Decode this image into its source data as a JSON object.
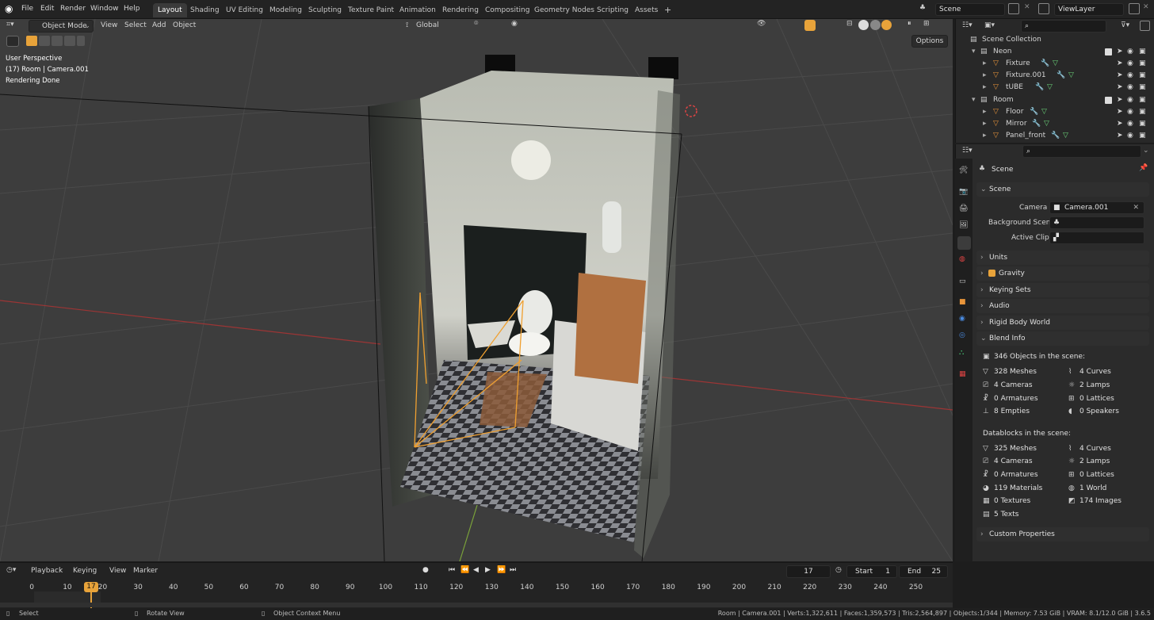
{
  "topbar": {
    "menus": [
      "File",
      "Edit",
      "Render",
      "Window",
      "Help"
    ],
    "workspaces": [
      "Layout",
      "Shading",
      "UV Editing",
      "Modeling",
      "Sculpting",
      "Texture Paint",
      "Animation",
      "Rendering",
      "Compositing",
      "Geometry Nodes",
      "Scripting",
      "Assets"
    ],
    "active_workspace": "Layout",
    "add_workspace": "+",
    "scene_label": "Scene",
    "viewlayer_label": "ViewLayer"
  },
  "viewport_header": {
    "mode": "Object Mode",
    "menus": [
      "View",
      "Select",
      "Add",
      "Object"
    ],
    "orientation": "Global",
    "options": "Options"
  },
  "viewport_overlay": {
    "line1": "User Perspective",
    "line2": "(17) Room | Camera.001",
    "line3": "Rendering Done"
  },
  "outliner": {
    "search_placeholder": "",
    "rows": [
      {
        "label": "Scene Collection",
        "depth": 0
      },
      {
        "label": "Neon",
        "depth": 1
      },
      {
        "label": "Fixture",
        "depth": 2
      },
      {
        "label": "Fixture.001",
        "depth": 2
      },
      {
        "label": "tUBE",
        "depth": 2
      },
      {
        "label": "Room",
        "depth": 1
      },
      {
        "label": "Floor",
        "depth": 2
      },
      {
        "label": "Mirror",
        "depth": 2
      },
      {
        "label": "Panel_front",
        "depth": 2
      }
    ]
  },
  "properties": {
    "context_title": "Scene",
    "scene_panel": {
      "title": "Scene",
      "camera_label": "Camera",
      "camera_value": "Camera.001",
      "background_label": "Background Scene",
      "clip_label": "Active Clip"
    },
    "collapsed_panels": [
      "Units",
      "Gravity",
      "Keying Sets",
      "Audio",
      "Rigid Body World"
    ],
    "blend_info": {
      "title": "Blend Info",
      "objects_heading": "346 Objects in the scene:",
      "objects": [
        {
          "left": "328 Meshes",
          "right": "4 Curves"
        },
        {
          "left": "4 Cameras",
          "right": "2 Lamps"
        },
        {
          "left": "0 Armatures",
          "right": "0 Lattices"
        },
        {
          "left": "8 Empties",
          "right": "0 Speakers"
        }
      ],
      "datablocks_heading": "Datablocks in the scene:",
      "datablocks": [
        {
          "left": "325 Meshes",
          "right": "4 Curves"
        },
        {
          "left": "4 Cameras",
          "right": "2 Lamps"
        },
        {
          "left": "0 Armatures",
          "right": "0 Lattices"
        },
        {
          "left": "119 Materials",
          "right": "1 World"
        },
        {
          "left": "0 Textures",
          "right": "174 Images"
        },
        {
          "left": "5 Texts",
          "right": ""
        }
      ]
    },
    "custom_properties": "Custom Properties"
  },
  "timeline": {
    "menus": [
      "Playback",
      "Keying",
      "View",
      "Marker"
    ],
    "current_frame": "17",
    "start_label": "Start",
    "start_value": "1",
    "end_label": "End",
    "end_value": "25",
    "ticks": [
      "0",
      "10",
      "20",
      "30",
      "40",
      "50",
      "60",
      "70",
      "80",
      "90",
      "100",
      "110",
      "120",
      "130",
      "140",
      "150",
      "160",
      "170",
      "180",
      "190",
      "200",
      "210",
      "220",
      "230",
      "240",
      "250"
    ],
    "playhead": "17"
  },
  "statusbar": {
    "select": "Select",
    "rotate": "Rotate View",
    "context": "Object Context Menu",
    "stats": "Room | Camera.001 | Verts:1,322,611 | Faces:1,359,573 | Tris:2,564,897 | Objects:1/344 | Memory: 7.53 GiB | VRAM: 8.1/12.0 GiB | 3.6.5"
  },
  "colors": {
    "accent": "#e8a33a",
    "active_tab": "#3a3a3a",
    "x_axis": "#a03a3a",
    "y_axis": "#6f9a34",
    "camera_frustum": "#f0a030"
  }
}
